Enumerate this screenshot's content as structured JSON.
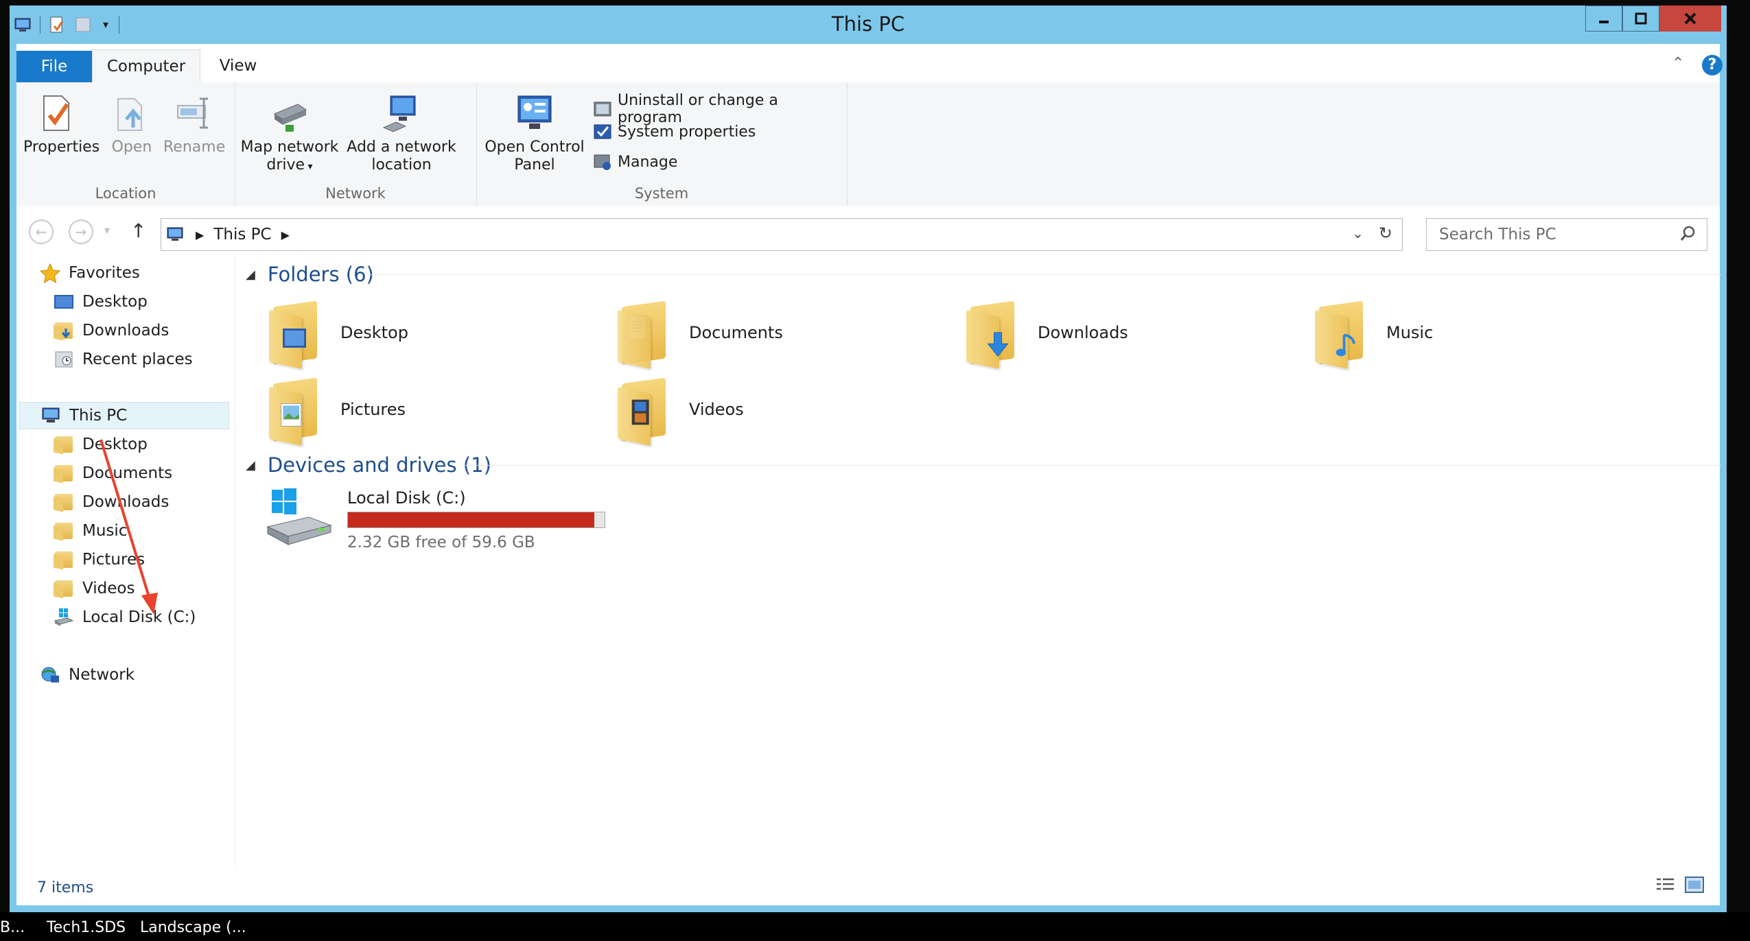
{
  "window": {
    "title": "This PC"
  },
  "ribbon": {
    "tabs": [
      "File",
      "Computer",
      "View"
    ],
    "location": {
      "label": "Location",
      "buttons": [
        "Properties",
        "Open",
        "Rename"
      ]
    },
    "network": {
      "label": "Network",
      "map_drive_line1": "Map network",
      "map_drive_line2": "drive",
      "add_location_line1": "Add a network",
      "add_location_line2": "location"
    },
    "system": {
      "label": "System",
      "open_cp_line1": "Open Control",
      "open_cp_line2": "Panel",
      "uninstall": "Uninstall or change a program",
      "system_properties": "System properties",
      "manage": "Manage"
    }
  },
  "address": {
    "path": "This PC",
    "search_placeholder": "Search This PC"
  },
  "navpane": {
    "favorites": "Favorites",
    "favorites_items": [
      "Desktop",
      "Downloads",
      "Recent places"
    ],
    "this_pc": "This PC",
    "this_pc_items": [
      "Desktop",
      "Documents",
      "Downloads",
      "Music",
      "Pictures",
      "Videos",
      "Local Disk (C:)"
    ],
    "network": "Network"
  },
  "content": {
    "folders_header": "Folders (6)",
    "folders": [
      "Desktop",
      "Documents",
      "Downloads",
      "Music",
      "Pictures",
      "Videos"
    ],
    "drives_header": "Devices and drives (1)",
    "drive": {
      "name": "Local Disk (C:)",
      "free_text": "2.32 GB free of 59.6 GB",
      "used_fraction": 0.961
    }
  },
  "status": {
    "items": "7 items"
  },
  "taskbar": {
    "items": [
      "B...",
      "Tech1.SDS",
      "Landscape (..."
    ]
  },
  "colors": {
    "accent": "#1979ca",
    "title_bar": "#7dc8ea",
    "close": "#c7463d",
    "drive_bar": "#c42b1c",
    "annotation_arrow": "#e8432e"
  }
}
